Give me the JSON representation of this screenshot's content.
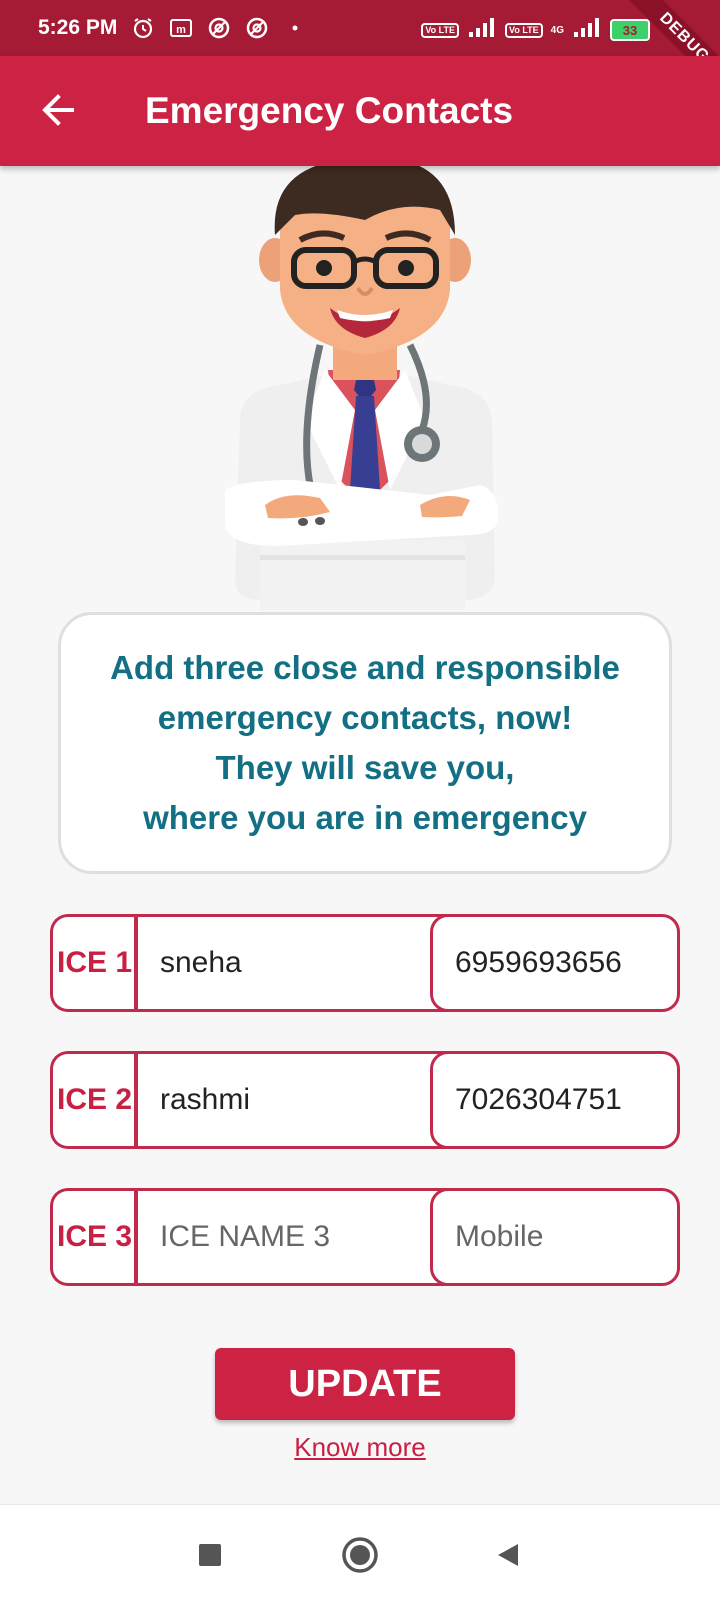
{
  "status_bar": {
    "time": "5:26 PM",
    "icons": [
      "alarm-icon",
      "m-icon",
      "no-disturb-icon",
      "no-disturb-icon",
      "dot-icon"
    ],
    "volte1": "Vo LTE",
    "volte2": "Vo LTE",
    "network_type": "4G",
    "battery": "33"
  },
  "debug_banner": "DEBUG",
  "app_bar": {
    "back_icon": "back-arrow-icon",
    "title": "Emergency Contacts"
  },
  "message": {
    "lines": [
      "Add three close and responsible",
      "emergency contacts, now!",
      "They will save you,",
      "where you are in emergency"
    ]
  },
  "contacts": [
    {
      "label": "ICE 1",
      "name": "sneha",
      "mobile": "6959693656",
      "name_placeholder": "",
      "mobile_placeholder": ""
    },
    {
      "label": "ICE 2",
      "name": "rashmi",
      "mobile": "7026304751",
      "name_placeholder": "",
      "mobile_placeholder": ""
    },
    {
      "label": "ICE 3",
      "name": "",
      "mobile": "",
      "name_placeholder": "ICE NAME 3",
      "mobile_placeholder": "Mobile"
    }
  ],
  "actions": {
    "update_label": "UPDATE",
    "know_more_label": "Know more"
  },
  "colors": {
    "status_bar": "#a51a35",
    "app_bar": "#cc2244",
    "accent_text": "#136f83",
    "field_border": "#c12a4b"
  },
  "nav_bar": {
    "icons": [
      "recents-square-icon",
      "home-circle-icon",
      "back-triangle-icon"
    ]
  }
}
